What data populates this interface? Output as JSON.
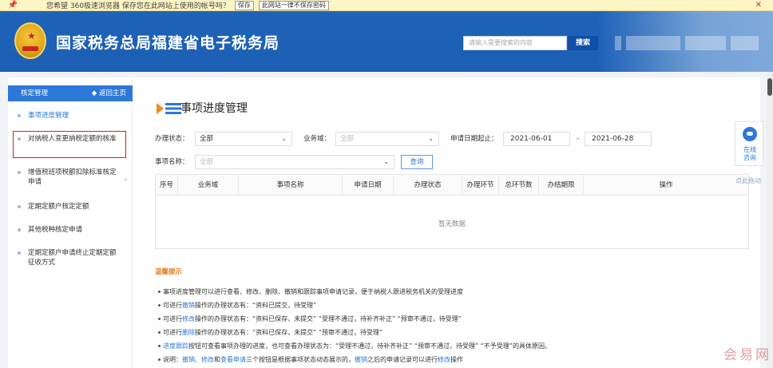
{
  "notification": {
    "message": "您希望 360极速浏览器 保存您在此网站上使用的帐号吗？",
    "save_label": "保存",
    "never_label": "此网站一律不保存密码",
    "close_icon": "close-icon"
  },
  "header": {
    "site_title": "国家税务总局福建省电子税务局",
    "search_placeholder": "请输入需要搜索的内容",
    "search_label": "搜索"
  },
  "sidebar": {
    "title": "核定管理",
    "home_label": "返回主页",
    "items": [
      {
        "label": "事项进度管理"
      },
      {
        "label": "对纳税人变更纳税定额的核准"
      },
      {
        "label": "增值税班项税额扣除标准核定申请"
      },
      {
        "label": "定期定额户核定定额"
      },
      {
        "label": "其他税种核定申请"
      },
      {
        "label": "定期定额户申请终止定期定额征收方式"
      }
    ]
  },
  "main": {
    "page_title": "事项进度管理",
    "filters": {
      "status_label": "办理状态：",
      "status_value": "全部",
      "domain_label": "业务域：",
      "domain_value": "全部",
      "date_label": "申请日期起止：",
      "date_from": "2021-06-01",
      "date_sep": "-",
      "date_to": "2021-06-28",
      "name_label": "事项名称：",
      "name_value": "全部",
      "query_label": "查询"
    },
    "table": {
      "columns": [
        "序号",
        "业务域",
        "事项名称",
        "申请日期",
        "办理状态",
        "办理环节",
        "总环节数",
        "办结期限",
        "操作"
      ],
      "empty_text": "暂无数据"
    },
    "tips": {
      "title": "温馨提示",
      "lines": [
        {
          "parts": [
            "事项进度管理可以进行查看、修改、删除、撤销和跟踪事项申请记录，便于纳税人跟进税务机关的受理进度"
          ]
        },
        {
          "pre": "可进行",
          "link": "撤销",
          "post": "操作的办理状态有：“资料已提交，待受理”"
        },
        {
          "pre": "可进行",
          "link": "修改",
          "post": "操作的办理状态有：“资料已保存，未提交”  “受理不通过，待补齐补正”  “预审不通过，待受理”"
        },
        {
          "pre": "可进行",
          "link": "删除",
          "post": "操作的办理状态有：“资料已保存，未提交”  “预审不通过，待受理”"
        },
        {
          "pre": "",
          "link": "进度跟踪",
          "post": "按钮可查看事项办理的进度，也可查看办理状态为：“受理不通过，待补齐补正”  “预审不通过，待受理”  “不予受理”的具体原因。"
        },
        {
          "pre": "说明：",
          "link": "撤销、修改",
          "mid": "和",
          "link2": "查看申请",
          "post": "三个按钮是根据事项状态动态展示的，",
          "link3": "撤销",
          "post2": "之后的申请记录可以进行",
          "link4": "修改",
          "post3": "操作"
        }
      ]
    }
  },
  "float_widget": {
    "label_line1": "在线",
    "label_line2": "咨询",
    "drag_label": "点此拖动"
  },
  "watermark": "会易网"
}
